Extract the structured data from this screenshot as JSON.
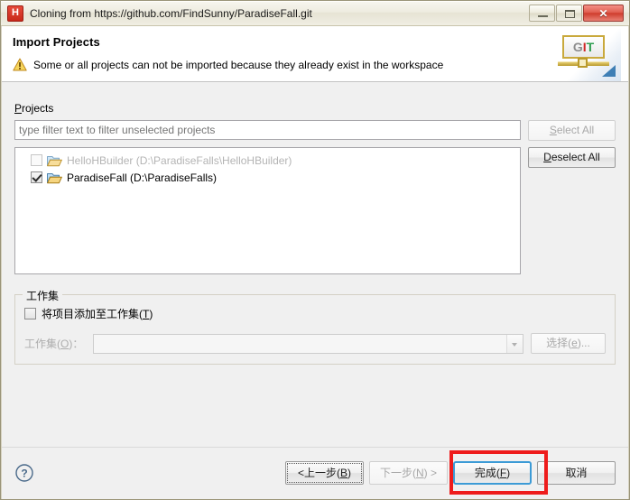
{
  "window": {
    "title": "Cloning from https://github.com/FindSunny/ParadiseFall.git",
    "app_icon": "hbuilder-icon",
    "controls": {
      "minimize": "minimize-icon",
      "maximize": "restore-icon",
      "close": "✕"
    }
  },
  "header": {
    "title": "Import Projects",
    "message": "Some or all projects can not be imported because they already exist in the workspace",
    "warning_icon": "warning-triangle-icon",
    "banner": {
      "text_g": "G",
      "text_i": "I",
      "text_t": "T"
    }
  },
  "content": {
    "projects_label_mnemonic": "P",
    "projects_label_rest": "rojects",
    "filter": {
      "value": "",
      "placeholder": "type filter text to filter unselected projects"
    },
    "projects": [
      {
        "label": "HelloHBuilder (D:\\ParadiseFalls\\HelloHBuilder)",
        "checked": false,
        "enabled": false,
        "icon": "folder-icon"
      },
      {
        "label": "ParadiseFall (D:\\ParadiseFalls)",
        "checked": true,
        "enabled": true,
        "icon": "folder-icon"
      }
    ],
    "select_all": {
      "mnemonic": "S",
      "rest": "elect All",
      "enabled": false
    },
    "deselect_all": {
      "mnemonic": "D",
      "rest": "eselect All",
      "enabled": true
    }
  },
  "working_sets": {
    "group_title": "工作集",
    "add_checkbox": {
      "label_main": "将项目添加至工作集(",
      "label_mnemonic": "T",
      "label_end": ")",
      "checked": false
    },
    "ws_label_main": "工作集(",
    "ws_label_mnemonic": "O",
    "ws_label_end": ")：",
    "ws_value": "",
    "select_button": {
      "label_main": "选择(",
      "label_mnemonic": "e",
      "label_end": ")...",
      "enabled": false
    }
  },
  "footer": {
    "help_icon": "question-mark-icon",
    "back": {
      "prefix": "<",
      "label_main": "上一步(",
      "label_mnemonic": "B",
      "label_end": ")",
      "enabled": true,
      "focused": true
    },
    "next": {
      "label_main": "下一步(",
      "label_mnemonic": "N",
      "label_end": ") >",
      "enabled": false
    },
    "finish": {
      "label_main": "完成(",
      "label_mnemonic": "F",
      "label_end": ")",
      "enabled": true,
      "is_default": true,
      "highlighted": true
    },
    "cancel": {
      "label": "取消",
      "enabled": true
    }
  },
  "colors": {
    "highlight_box": "#ee1c1c",
    "default_button_border": "#3c9bd6",
    "app_icon_bg": "#c9281a",
    "warning": "#e8a317"
  }
}
